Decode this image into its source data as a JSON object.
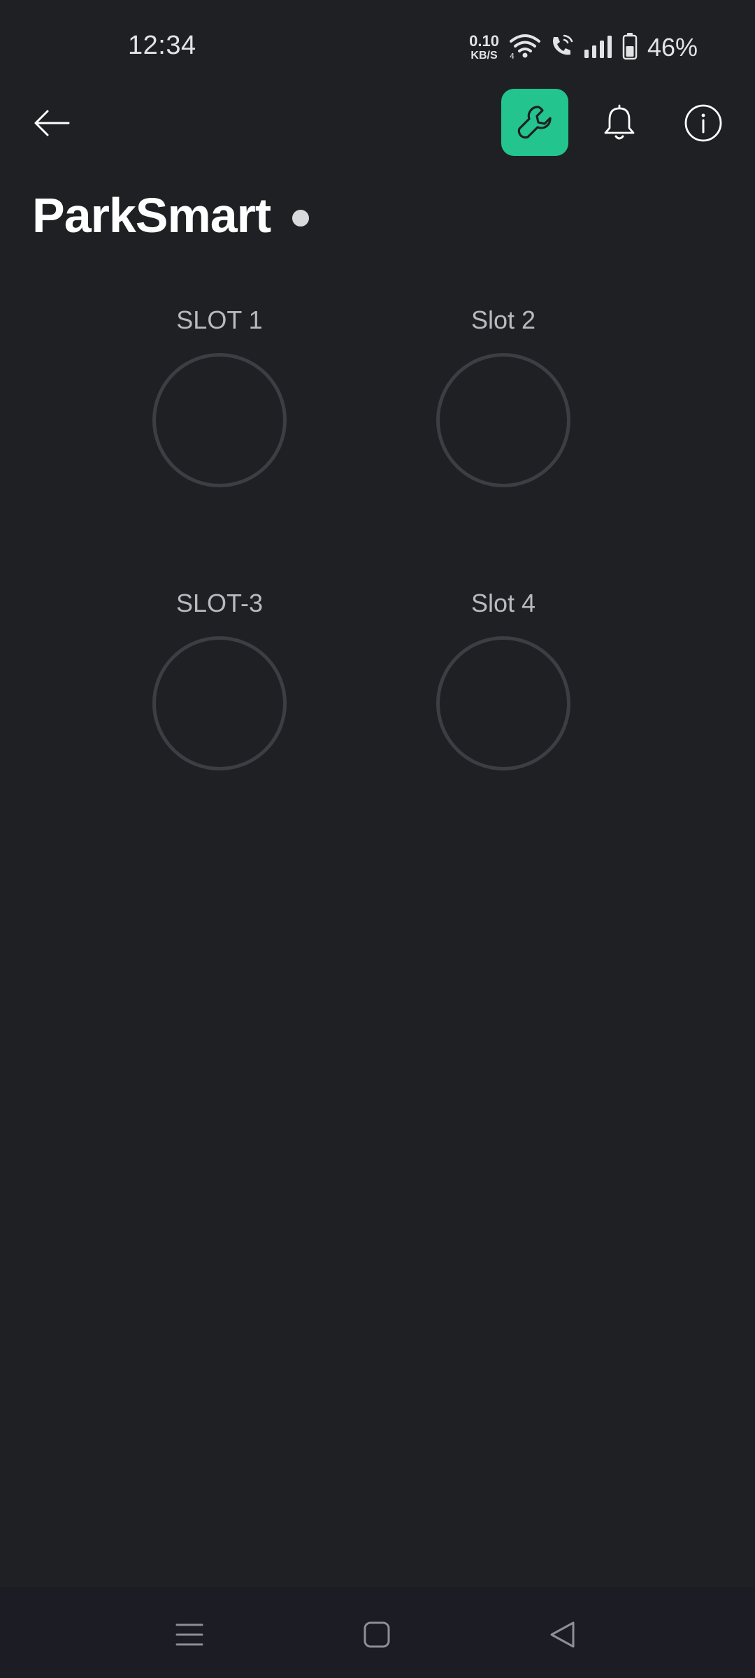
{
  "status_bar": {
    "time": "12:34",
    "net_speed_value": "0.10",
    "net_speed_unit": "KB/S",
    "battery_percent": "46%",
    "icons": [
      "wifi-icon",
      "wifi-calling-icon",
      "signal-icon",
      "battery-icon"
    ]
  },
  "header": {
    "back_icon": "arrow-left-icon",
    "actions": [
      "wrench-icon",
      "bell-icon",
      "info-icon"
    ],
    "accent_color": "#23c48e"
  },
  "page": {
    "title": "ParkSmart",
    "status_dot_color": "#d9d9db"
  },
  "slots": [
    {
      "label": "SLOT 1"
    },
    {
      "label": "Slot 2"
    },
    {
      "label": "SLOT-3"
    },
    {
      "label": "Slot 4"
    }
  ],
  "nav_bar": {
    "buttons": [
      "menu-icon",
      "home-icon",
      "back-triangle-icon"
    ]
  }
}
